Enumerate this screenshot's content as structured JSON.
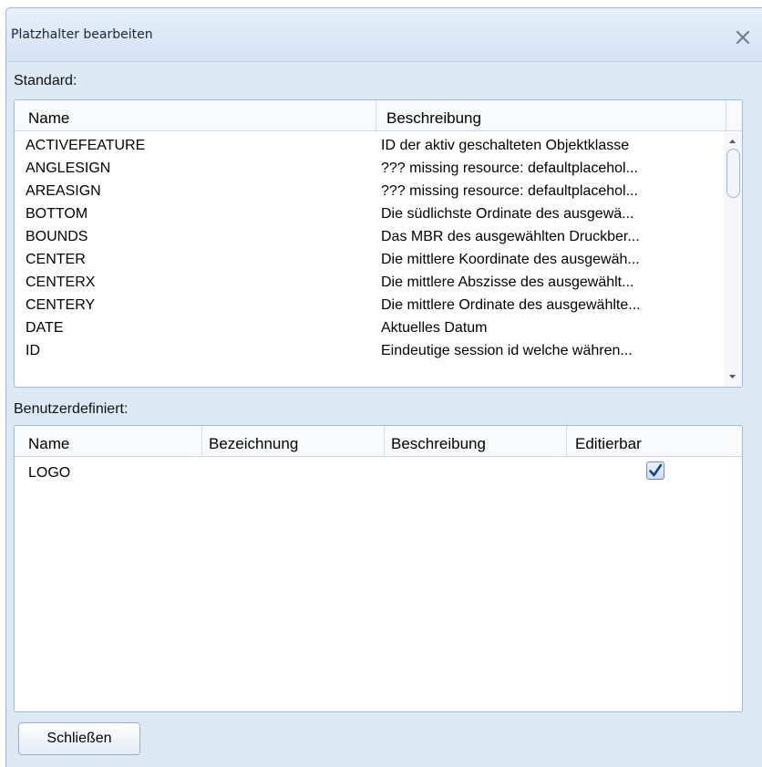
{
  "dialog": {
    "title": "Platzhalter bearbeiten"
  },
  "standard": {
    "label": "Standard:",
    "columns": [
      "Name",
      "Beschreibung"
    ],
    "rows": [
      {
        "name": "ACTIVEFEATURE",
        "desc": "ID der aktiv geschalteten Objektklasse"
      },
      {
        "name": "ANGLESIGN",
        "desc": "??? missing resource: defaultplacehol..."
      },
      {
        "name": "AREASIGN",
        "desc": "??? missing resource: defaultplacehol..."
      },
      {
        "name": "BOTTOM",
        "desc": "Die südlichste Ordinate des ausgewä..."
      },
      {
        "name": "BOUNDS",
        "desc": "Das MBR des ausgewählten Druckber..."
      },
      {
        "name": "CENTER",
        "desc": "Die mittlere Koordinate des ausgewäh..."
      },
      {
        "name": "CENTERX",
        "desc": "Die mittlere Abszisse des ausgewählt..."
      },
      {
        "name": "CENTERY",
        "desc": "Die mittlere Ordinate des ausgewählte..."
      },
      {
        "name": "DATE",
        "desc": "Aktuelles Datum"
      },
      {
        "name": "ID",
        "desc": "Eindeutige session id welche währen..."
      }
    ]
  },
  "custom": {
    "label": "Benutzerdefiniert:",
    "columns": [
      "Name",
      "Bezeichnung",
      "Beschreibung",
      "Editierbar"
    ],
    "rows": [
      {
        "name": "LOGO",
        "bezeichnung": "",
        "beschreibung": "",
        "editierbar": true
      }
    ]
  },
  "buttons": {
    "close_label": "Schließen"
  },
  "colors": {
    "dialog_bg": "#dde8f5",
    "border": "#99bbe8",
    "check": "#15428b"
  }
}
